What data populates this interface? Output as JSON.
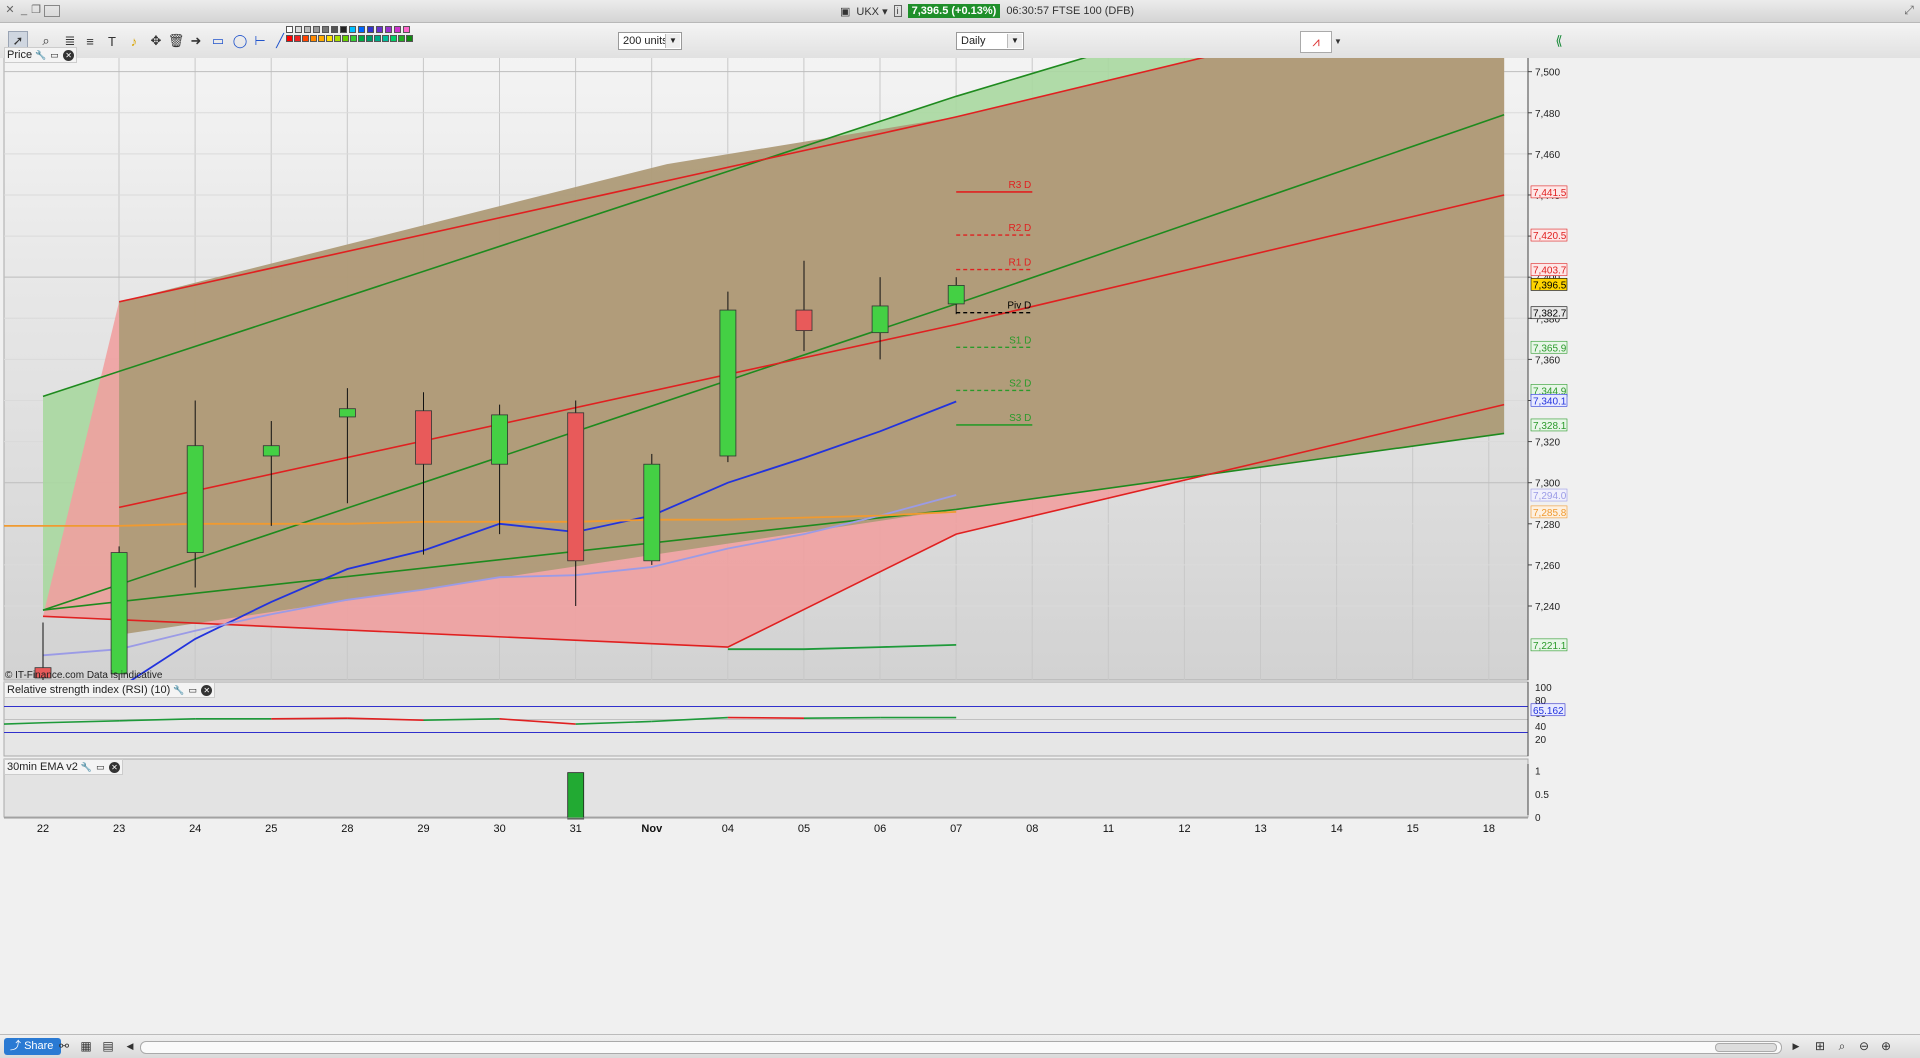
{
  "window": {
    "symbol": "UKX",
    "price_badge": "7,396.5 (+0.13%)",
    "title_text": "06:30:57 FTSE 100 (DFB)"
  },
  "toolbar": {
    "units_select": "200 units",
    "period_select": "Daily"
  },
  "panels": {
    "price_label": "Price",
    "rsi_label": "Relative strength index (RSI) (10)",
    "ema_label": "30min EMA v2",
    "watermark": "© IT-Finance.com  Data is indicative"
  },
  "footer": {
    "share_label": "Share"
  },
  "colors": {
    "up_candle": "#44d044",
    "down_candle": "#e85a5a",
    "red_channel": "#f0a0a0",
    "green_channel": "#a8d8a0",
    "overlap_fill": "#ae9b78",
    "sma_blue": "#2233dd",
    "sma_lavender": "#9b9be6",
    "sma_orange": "#f09a30",
    "sma_green": "#1e9a3a"
  },
  "chart_data": {
    "type": "candlestick",
    "x_tick_labels": [
      "22",
      "23",
      "24",
      "25",
      "28",
      "29",
      "30",
      "31",
      "Nov",
      "04",
      "05",
      "06",
      "07",
      "08",
      "11",
      "12",
      "13",
      "14",
      "15",
      "18"
    ],
    "price_axis": {
      "ylim": [
        7204,
        7512
      ],
      "ticks": [
        7240,
        7260,
        7280,
        7300,
        7320,
        7340,
        7360,
        7380,
        7400,
        7420,
        7440,
        7460,
        7480,
        7500
      ],
      "tick_labels": [
        "7,240",
        "7,260",
        "7,280",
        "7,300",
        "7,320",
        "7,340",
        "7,360",
        "7,380",
        "7,400",
        "7,420",
        "7,440",
        "7,460",
        "7,480",
        "7,500"
      ]
    },
    "candles": [
      {
        "date": "22",
        "open": 7210,
        "high": 7232,
        "low": 7200,
        "close": 7205
      },
      {
        "date": "23",
        "open": 7207,
        "high": 7269,
        "low": 7200,
        "close": 7266
      },
      {
        "date": "24",
        "open": 7266,
        "high": 7340,
        "low": 7249,
        "close": 7318
      },
      {
        "date": "25",
        "open": 7313,
        "high": 7330,
        "low": 7279,
        "close": 7318
      },
      {
        "date": "28",
        "open": 7332,
        "high": 7346,
        "low": 7290,
        "close": 7336
      },
      {
        "date": "29",
        "open": 7335,
        "high": 7344,
        "low": 7265,
        "close": 7309
      },
      {
        "date": "30",
        "open": 7309,
        "high": 7338,
        "low": 7275,
        "close": 7333
      },
      {
        "date": "31",
        "open": 7334,
        "high": 7340,
        "low": 7240,
        "close": 7262
      },
      {
        "date": "Nov",
        "open": 7262,
        "high": 7314,
        "low": 7260,
        "close": 7309
      },
      {
        "date": "04",
        "open": 7313,
        "high": 7393,
        "low": 7310,
        "close": 7384
      },
      {
        "date": "05",
        "open": 7384,
        "high": 7408,
        "low": 7364,
        "close": 7374
      },
      {
        "date": "06",
        "open": 7373,
        "high": 7400,
        "low": 7360,
        "close": 7386
      },
      {
        "date": "07",
        "open": 7387,
        "high": 7400,
        "low": 7382,
        "close": 7396
      }
    ],
    "moving_averages": [
      {
        "color_key": "sma_blue",
        "values": [
          7196,
          7200,
          7224,
          7242,
          7258,
          7267,
          7280,
          7276,
          7284,
          7300,
          7312,
          7325,
          7339.5
        ]
      },
      {
        "color_key": "sma_lavender",
        "values": [
          7216,
          7219,
          7228,
          7236,
          7243,
          7248,
          7254,
          7255,
          7259,
          7268,
          7275,
          7284,
          7294
        ]
      },
      {
        "color_key": "sma_orange",
        "values": [
          7279,
          7279,
          7280,
          7280,
          7280,
          7281,
          7281,
          7281,
          7282,
          7282,
          7283,
          7284,
          7285.8
        ]
      },
      {
        "color_key": "sma_green",
        "values": [
          null,
          null,
          null,
          null,
          null,
          null,
          null,
          null,
          null,
          7219,
          7219,
          7220,
          7221.1
        ]
      }
    ],
    "channels": [
      {
        "color_key": "green",
        "upper": [
          [
            0,
            7342
          ],
          [
            12,
            7488
          ],
          [
            19.2,
            7568
          ]
        ],
        "lower": [
          [
            0,
            7238
          ],
          [
            12,
            7287
          ],
          [
            19.2,
            7324
          ]
        ],
        "middle": [
          [
            0,
            7238
          ],
          [
            12,
            7387
          ],
          [
            19.2,
            7479
          ]
        ]
      },
      {
        "color_key": "red",
        "upper": [
          [
            1,
            7388
          ],
          [
            12,
            7478
          ],
          [
            19.2,
            7542
          ]
        ],
        "lower": [
          [
            0,
            7235
          ],
          [
            9,
            7220
          ],
          [
            12,
            7275
          ],
          [
            19.2,
            7338
          ]
        ],
        "middle": [
          [
            1,
            7288
          ],
          [
            12,
            7377
          ],
          [
            19.2,
            7440
          ]
        ]
      }
    ],
    "pivots": [
      {
        "label": "R3 D",
        "value": 7441.5,
        "style": "solid",
        "color": "#e02020"
      },
      {
        "label": "R2 D",
        "value": 7420.5,
        "style": "dashed",
        "color": "#e02020"
      },
      {
        "label": "R1 D",
        "value": 7403.7,
        "style": "dashed",
        "color": "#e02020"
      },
      {
        "label": "Piv D",
        "value": 7382.7,
        "style": "dashed",
        "color": "#000000"
      },
      {
        "label": "S1 D",
        "value": 7365.9,
        "style": "dashed",
        "color": "#2a9a2a"
      },
      {
        "label": "S2 D",
        "value": 7344.9,
        "style": "dashed",
        "color": "#2a9a2a"
      },
      {
        "label": "S3 D",
        "value": 7328.1,
        "style": "solid",
        "color": "#2a9a2a"
      }
    ],
    "price_tags": [
      {
        "text": "7,441.5",
        "value": 7441.5,
        "color": "#e02020",
        "bg": "#fde8e8"
      },
      {
        "text": "7,420.5",
        "value": 7420.5,
        "color": "#e02020",
        "bg": "#fde8e8"
      },
      {
        "text": "7,403.7",
        "value": 7403.7,
        "color": "#e02020",
        "bg": "#fde8e8"
      },
      {
        "text": "7,396.5",
        "value": 7396.5,
        "color": "#000000",
        "bg": "#ffd400"
      },
      {
        "text": "7,382.7",
        "value": 7382.7,
        "color": "#000000",
        "bg": "#e8e8e8"
      },
      {
        "text": "7,365.9",
        "value": 7365.9,
        "color": "#2a9a2a",
        "bg": "#e8f6e8"
      },
      {
        "text": "7,344.9",
        "value": 7344.9,
        "color": "#2a9a2a",
        "bg": "#e8f6e8"
      },
      {
        "text": "7,340.1",
        "value": 7340.1,
        "color": "#2233dd",
        "bg": "#e8eaff"
      },
      {
        "text": "7,328.1",
        "value": 7328.1,
        "color": "#2a9a2a",
        "bg": "#e8f6e8"
      },
      {
        "text": "7,294.0",
        "value": 7294.0,
        "color": "#9b9be6",
        "bg": "#f0f0fc"
      },
      {
        "text": "7,285.8",
        "value": 7285.8,
        "color": "#f09a30",
        "bg": "#fdf0e0"
      },
      {
        "text": "7,221.1",
        "value": 7221.1,
        "color": "#2a9a2a",
        "bg": "#e8f6e8"
      }
    ],
    "rsi": {
      "ylim": [
        0,
        100
      ],
      "ticks": [
        20,
        40,
        60,
        80,
        100
      ],
      "tick_labels": [
        "20",
        "40",
        "60",
        "80",
        "100"
      ],
      "upper_band": 70,
      "lower_band": 30,
      "values": [
        45,
        48,
        51,
        51,
        52,
        49,
        51,
        43,
        47,
        53,
        52,
        53,
        53
      ],
      "colors": [
        "up",
        "up",
        "up",
        "up",
        "down",
        "down",
        "up",
        "down",
        "up",
        "up",
        "down",
        "up",
        "up"
      ],
      "current_label": "65.162"
    },
    "ema_indicator": {
      "ylim": [
        0,
        1.1
      ],
      "ticks": [
        0,
        0.5,
        1
      ],
      "tick_labels": [
        "0",
        "0.5",
        "1"
      ],
      "bars": [
        0,
        0,
        0,
        0,
        0,
        0,
        0,
        1,
        0,
        0,
        0,
        0,
        0
      ]
    }
  }
}
